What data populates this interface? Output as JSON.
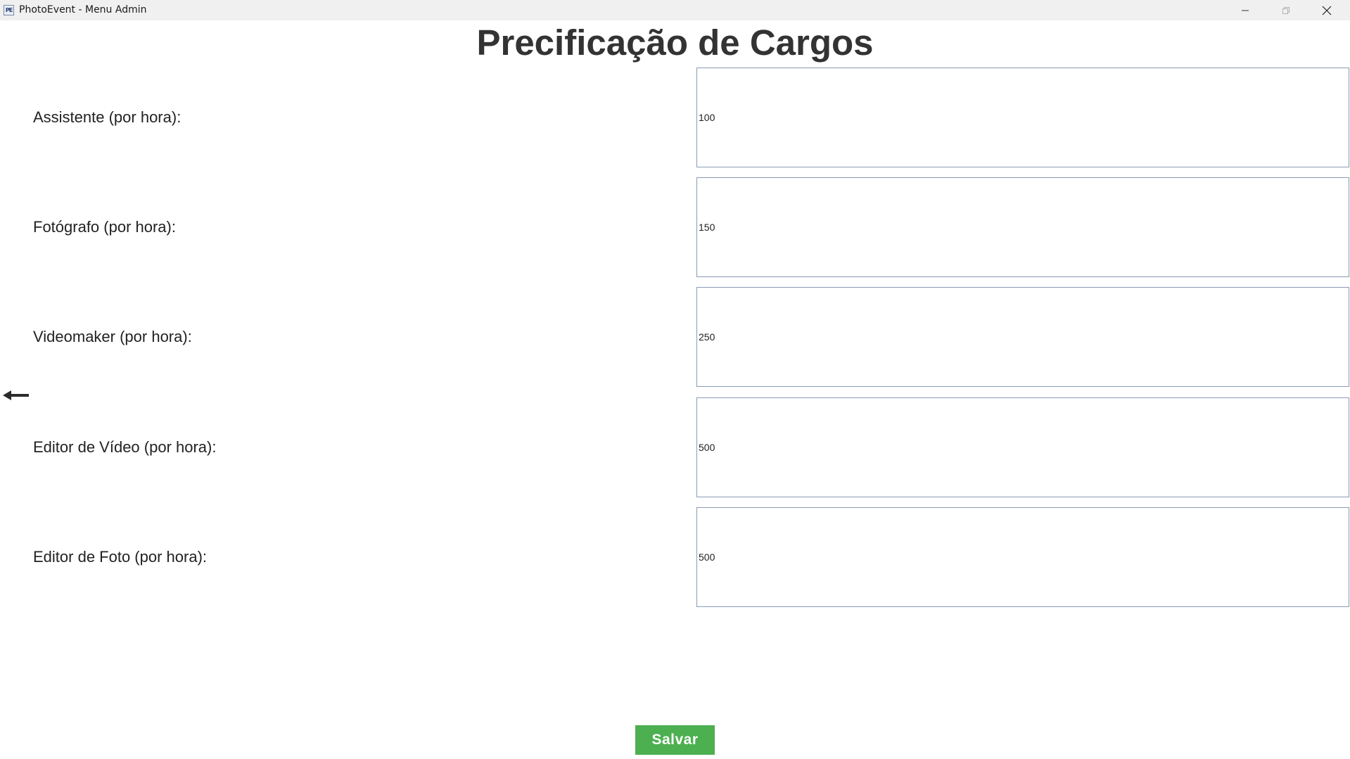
{
  "window": {
    "title": "PhotoEvent - Menu Admin",
    "app_icon_text": "PE"
  },
  "page": {
    "title": "Precificação de Cargos"
  },
  "rows": [
    {
      "label": "Assistente (por hora):",
      "value": "100"
    },
    {
      "label": "Fotógrafo (por hora):",
      "value": "150"
    },
    {
      "label": "Videomaker (por hora):",
      "value": "250"
    },
    {
      "label": "Editor de Vídeo (por hora):",
      "value": "500"
    },
    {
      "label": "Editor de Foto (por hora):",
      "value": "500"
    }
  ],
  "actions": {
    "save_label": "Salvar",
    "save_color": "#4caf50"
  },
  "icons": {
    "back": "arrow-left-icon",
    "minimize": "minimize-icon",
    "maximize": "maximize-icon",
    "close": "close-icon"
  }
}
